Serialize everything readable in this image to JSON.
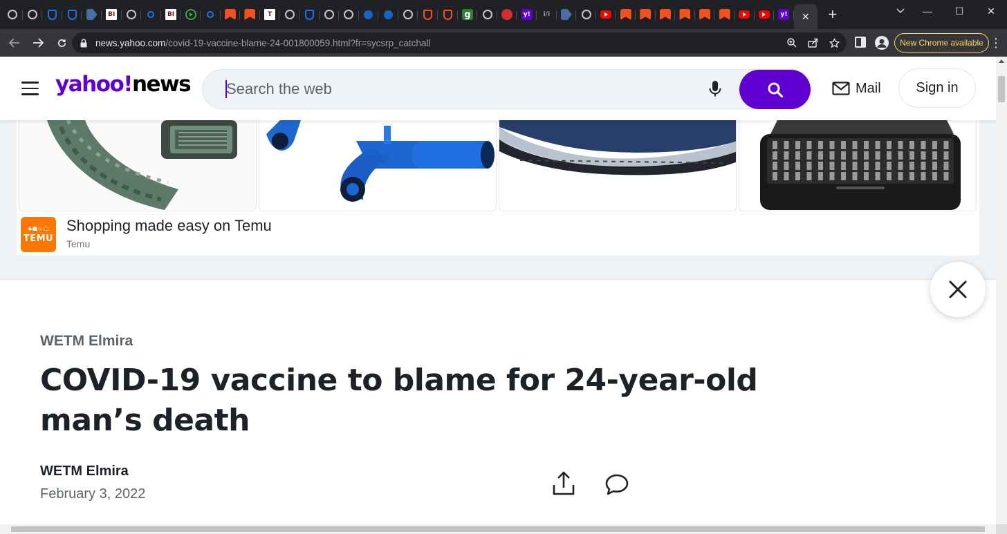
{
  "browser": {
    "tab_favicons": [
      {
        "icon": "globe-icon",
        "color": "#5f6368",
        "glyph": ""
      },
      {
        "icon": "globe-icon",
        "color": "#5f6368",
        "glyph": ""
      },
      {
        "icon": "shield-icon",
        "color": "#1a73e8",
        "glyph": ""
      },
      {
        "icon": "shield-icon",
        "color": "#1a73e8",
        "glyph": ""
      },
      {
        "icon": "arrow-icon",
        "color": "#4a6fa5",
        "glyph": ""
      },
      {
        "icon": "bi-icon",
        "color": "#ffffff",
        "glyph": "BI"
      },
      {
        "icon": "globe-icon",
        "color": "#5f6368",
        "glyph": ""
      },
      {
        "icon": "search-icon",
        "color": "#1a73e8",
        "glyph": ""
      },
      {
        "icon": "bi-icon",
        "color": "#ffffff",
        "glyph": "BI"
      },
      {
        "icon": "play-icon",
        "color": "#43a047",
        "glyph": ""
      },
      {
        "icon": "search-icon",
        "color": "#1a73e8",
        "glyph": ""
      },
      {
        "icon": "bookmark-icon",
        "color": "#f4511e",
        "glyph": ""
      },
      {
        "icon": "bookmark-icon",
        "color": "#f4511e",
        "glyph": ""
      },
      {
        "icon": "newspaper-icon",
        "color": "#ffffff",
        "glyph": "T"
      },
      {
        "icon": "globe-icon",
        "color": "#5f6368",
        "glyph": ""
      },
      {
        "icon": "shield-icon",
        "color": "#1a73e8",
        "glyph": ""
      },
      {
        "icon": "globe-icon",
        "color": "#5f6368",
        "glyph": ""
      },
      {
        "icon": "globe-icon",
        "color": "#5f6368",
        "glyph": ""
      },
      {
        "icon": "cube-icon",
        "color": "#1565c0",
        "glyph": ""
      },
      {
        "icon": "cube-icon",
        "color": "#1565c0",
        "glyph": ""
      },
      {
        "icon": "globe-icon",
        "color": "#5f6368",
        "glyph": ""
      },
      {
        "icon": "shield-icon",
        "color": "#f4511e",
        "glyph": ""
      },
      {
        "icon": "shield-icon",
        "color": "#f4511e",
        "glyph": ""
      },
      {
        "icon": "g-icon",
        "color": "#2e7d32",
        "glyph": "g"
      },
      {
        "icon": "globe-icon",
        "color": "#5f6368",
        "glyph": ""
      },
      {
        "icon": "podcast-icon",
        "color": "#d32f2f",
        "glyph": ""
      },
      {
        "icon": "yahoo-icon",
        "color": "#6001d2",
        "glyph": "y!"
      },
      {
        "icon": "italic-icon",
        "color": "#9e9e9e",
        "glyph": "i/i"
      },
      {
        "icon": "arrow-icon",
        "color": "#4a6fa5",
        "glyph": ""
      },
      {
        "icon": "globe-icon",
        "color": "#5f6368",
        "glyph": ""
      },
      {
        "icon": "youtube-icon",
        "color": "#ff0000",
        "glyph": ""
      },
      {
        "icon": "bookmark-icon",
        "color": "#f4511e",
        "glyph": ""
      },
      {
        "icon": "bookmark-icon",
        "color": "#f4511e",
        "glyph": ""
      },
      {
        "icon": "bookmark-icon",
        "color": "#f4511e",
        "glyph": ""
      },
      {
        "icon": "bookmark-icon",
        "color": "#f4511e",
        "glyph": ""
      },
      {
        "icon": "bookmark-icon",
        "color": "#f4511e",
        "glyph": ""
      },
      {
        "icon": "bookmark-icon",
        "color": "#f4511e",
        "glyph": ""
      },
      {
        "icon": "youtube-icon",
        "color": "#ff0000",
        "glyph": ""
      },
      {
        "icon": "youtube-icon",
        "color": "#ff0000",
        "glyph": ""
      },
      {
        "icon": "yahoo-icon",
        "color": "#6001d2",
        "glyph": "y!"
      }
    ],
    "active_tab_close": "✕",
    "new_tab": "+",
    "url_host": "news.yahoo.com",
    "url_path": "/covid-19-vaccine-blame-24-001800059.html?fr=sycsrp_catchall",
    "new_chrome_label": "New Chrome available",
    "menu_dots": "⋮",
    "window_controls": [
      "—",
      "☐",
      "✕"
    ]
  },
  "header": {
    "logo_yahoo": "yahoo!",
    "logo_news": "news",
    "search_placeholder": "Search the web",
    "mail_label": "Mail",
    "signin_label": "Sign in"
  },
  "ad": {
    "title": "Shopping made easy on Temu",
    "sponsor": "Temu",
    "logo_text": "TEMU",
    "products": [
      "camo-watch-band",
      "blue-bike-handlebar-extender",
      "navy-hiking-shoe",
      "precision-screwdriver-bit-set"
    ]
  },
  "article": {
    "provider": "WETM Elmira",
    "headline": "COVID-19 vaccine to blame for 24-year-old man’s death",
    "author": "WETM Elmira",
    "date": "February 3, 2022"
  },
  "colors": {
    "yahoo_purple": "#6001d2",
    "text_dark": "#1d2228",
    "text_muted": "#5b636a",
    "chrome_dark": "#202124",
    "chrome_toolbar": "#35363a",
    "new_chrome_yellow": "#fdd663",
    "temu_orange": "#fb7701"
  }
}
